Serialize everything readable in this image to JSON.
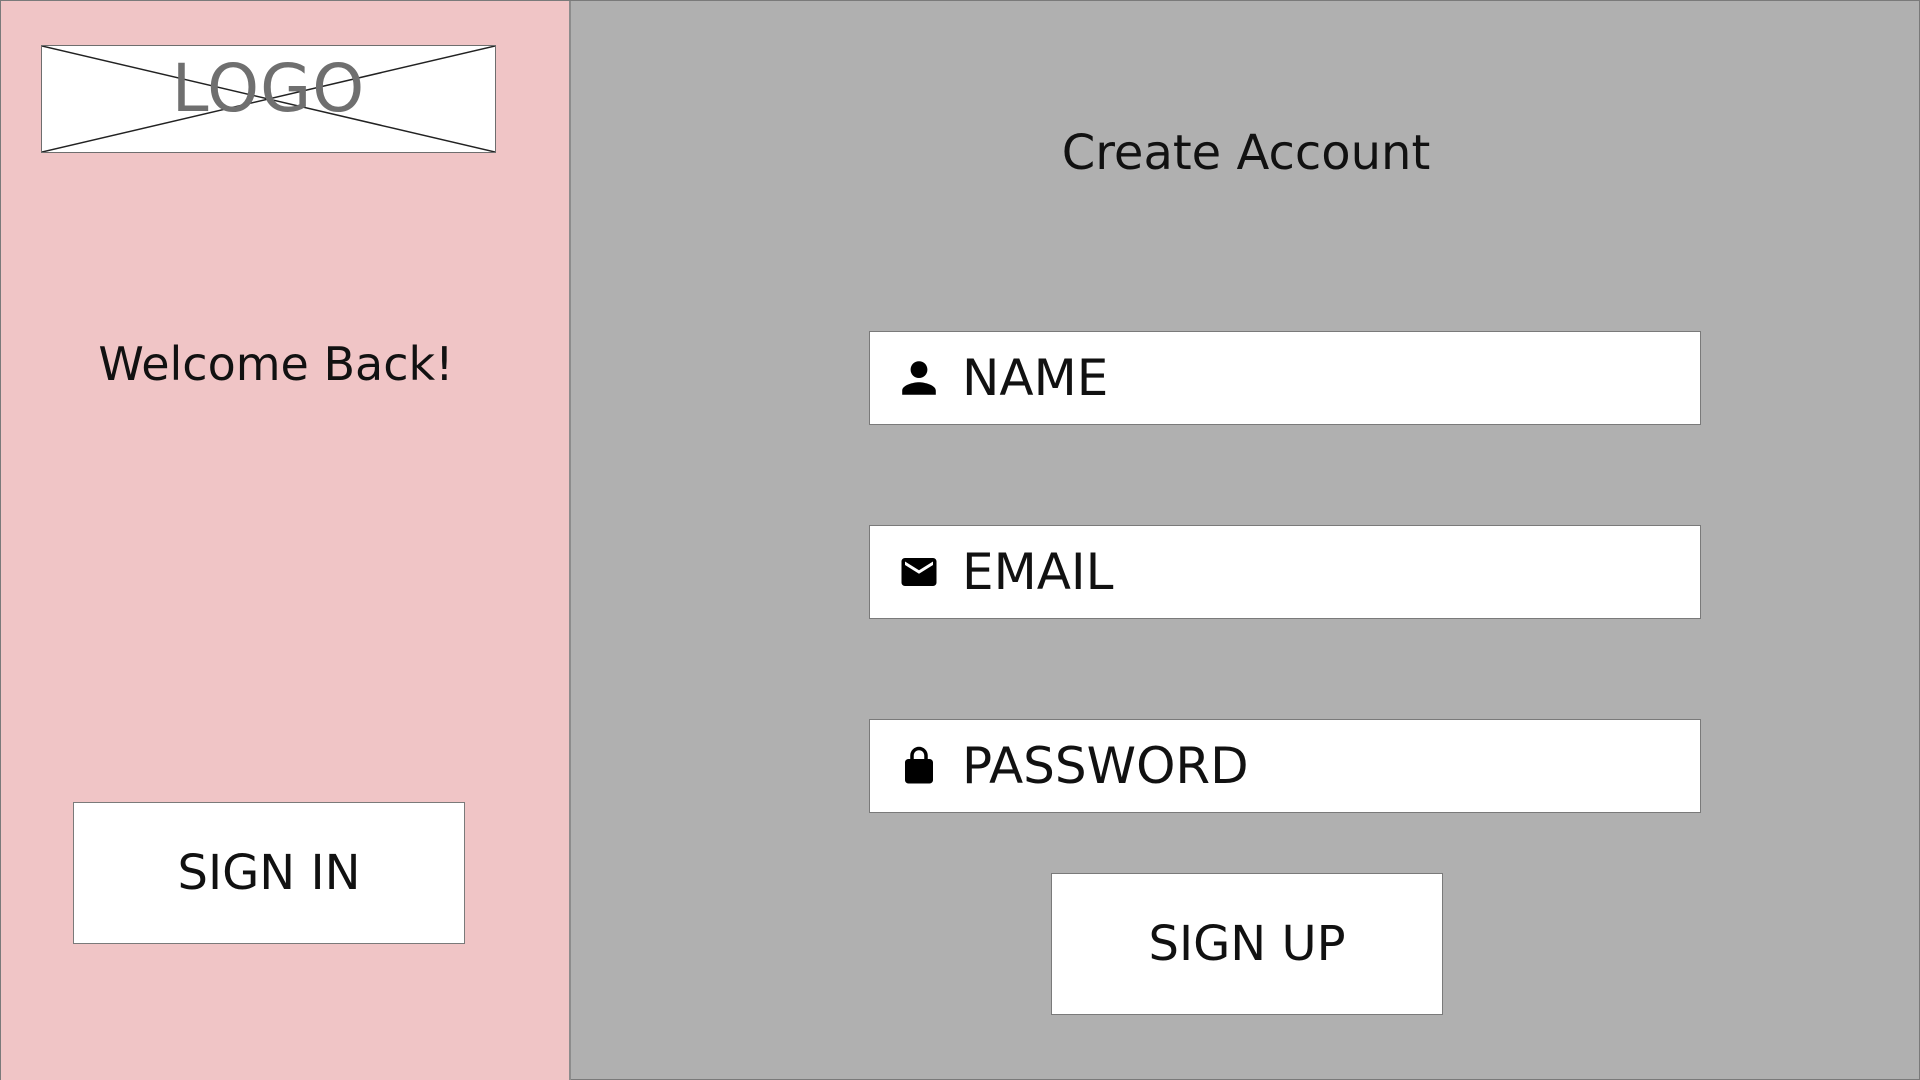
{
  "left_panel": {
    "logo_text": "LOGO",
    "welcome_text": "Welcome Back!",
    "signin_label": "SIGN IN",
    "background_color": "#f0c5c6"
  },
  "right_panel": {
    "title": "Create Account",
    "background_color": "#b0b0b0",
    "fields": [
      {
        "label": "NAME",
        "icon": "person-icon"
      },
      {
        "label": "EMAIL",
        "icon": "mail-icon"
      },
      {
        "label": "PASSWORD",
        "icon": "lock-icon"
      }
    ],
    "signup_label": "SIGN UP"
  }
}
